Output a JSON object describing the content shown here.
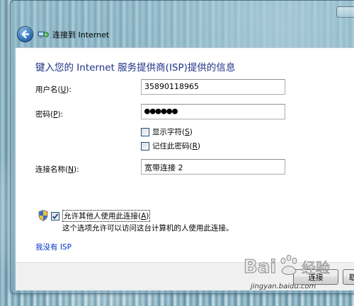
{
  "window": {
    "title": "连接到 Internet"
  },
  "form": {
    "heading": "键入您的 Internet 服务提供商(ISP)提供的信息",
    "username": {
      "label": "用户名(",
      "accel": "U",
      "label_end": "):",
      "value": "35890118965"
    },
    "password": {
      "label": "密码(",
      "accel": "P",
      "label_end": "):",
      "value": "●●●●●●"
    },
    "show_chars": {
      "label": "显示字符(",
      "accel": "S",
      "label_end": ")",
      "checked": false
    },
    "remember_password": {
      "label": "记住此密码(",
      "accel": "R",
      "label_end": ")",
      "checked": false
    },
    "connection_name": {
      "label": "连接名称(",
      "accel": "N",
      "label_end": "):",
      "value": "宽带连接 2"
    },
    "allow_others": {
      "label": "允许其他人使用此连接(",
      "accel": "A",
      "label_end": ")",
      "checked": true,
      "description": "这个选项允许可以访问这台计算机的人使用此连接。"
    },
    "no_isp_link": "我没有 ISP"
  },
  "footer": {
    "connect_button_label": "连接",
    "cancel_button_label": "取"
  },
  "watermark": {
    "brand": "Baidu经验",
    "url": "jingyan.baidu.com"
  },
  "icons": {
    "back": "back-arrow-icon",
    "network": "network-connection-icon",
    "shield": "uac-shield-icon"
  },
  "colors": {
    "heading": "#1e3287",
    "link": "#0033cc"
  }
}
